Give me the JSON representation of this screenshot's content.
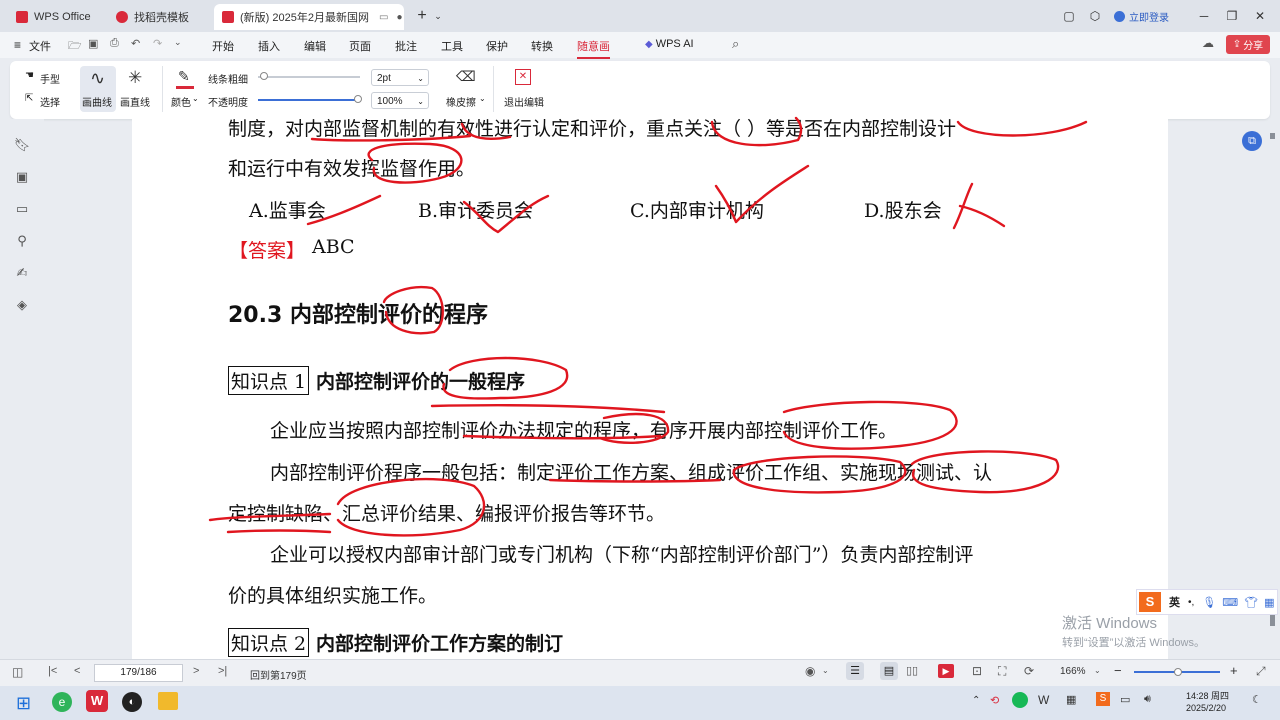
{
  "tabs": [
    {
      "label": "WPS Office",
      "icon_color": "#d9293a"
    },
    {
      "label": "找稻壳模板",
      "icon_color": "#d9293a"
    },
    {
      "label": "(新版) 2025年2月最新国网",
      "icon_color": "#d9293a"
    }
  ],
  "titlebar": {
    "login_label": "立即登录"
  },
  "menu": {
    "file": "文件",
    "items": [
      "开始",
      "插入",
      "编辑",
      "页面",
      "批注",
      "工具",
      "保护",
      "转换",
      "随意画"
    ],
    "active": "随意画",
    "wps_ai": "WPS AI",
    "share": "分享"
  },
  "toolbar": {
    "hand": "手型",
    "select": "选择",
    "curve": "画曲线",
    "line": "画直线",
    "color": "颜色",
    "stroke_label": "线条粗细",
    "stroke_value": "2pt",
    "opacity_label": "不透明度",
    "opacity_value": "100%",
    "eraser": "橡皮擦",
    "exit": "退出编辑",
    "accent": "#d9293a"
  },
  "document": {
    "line1": "制度，对内部监督机制的有效性进行认定和评价，重点关注（        ）等是否在内部控制设计",
    "line2": "和运行中有效发挥监督作用。",
    "opt_a": "A.监事会",
    "opt_b": "B.审计委员会",
    "opt_c": "C.内部审计机构",
    "opt_d": "D.股东会",
    "answer_label": "【答案】",
    "answer_value": "ABC",
    "section_title": "20.3  内部控制评价的程序",
    "kp1_box": "知识点 1",
    "kp1_title": "内部控制评价的一般程序",
    "para1": "企业应当按照内部控制评价办法规定的程序，有序开展内部控制评价工作。",
    "para2a": "内部控制评价程序一般包括：制定评价工作方案、组成评价工作组、实施现场测试、认",
    "para2b": "定控制缺陷、汇总评价结果、编报评价报告等环节。",
    "para3a": "企业可以授权内部审计部门或专门机构（下称“内部控制评价部门”）负责内部控制评",
    "para3b": "价的具体组织实施工作。",
    "kp2_box": "知识点 2",
    "kp2_title": "内部控制评价工作方案的制订"
  },
  "ink_color": "#e0161f",
  "watermark": {
    "line1": "激活 Windows",
    "line2": "转到“设置”以激活 Windows。"
  },
  "ime": {
    "lang": "英"
  },
  "status": {
    "page_box": "179/186",
    "goto": "回到第179页",
    "zoom": "166%"
  },
  "taskbar": {
    "time": "14:28 周四",
    "date": "2025/2/20"
  }
}
